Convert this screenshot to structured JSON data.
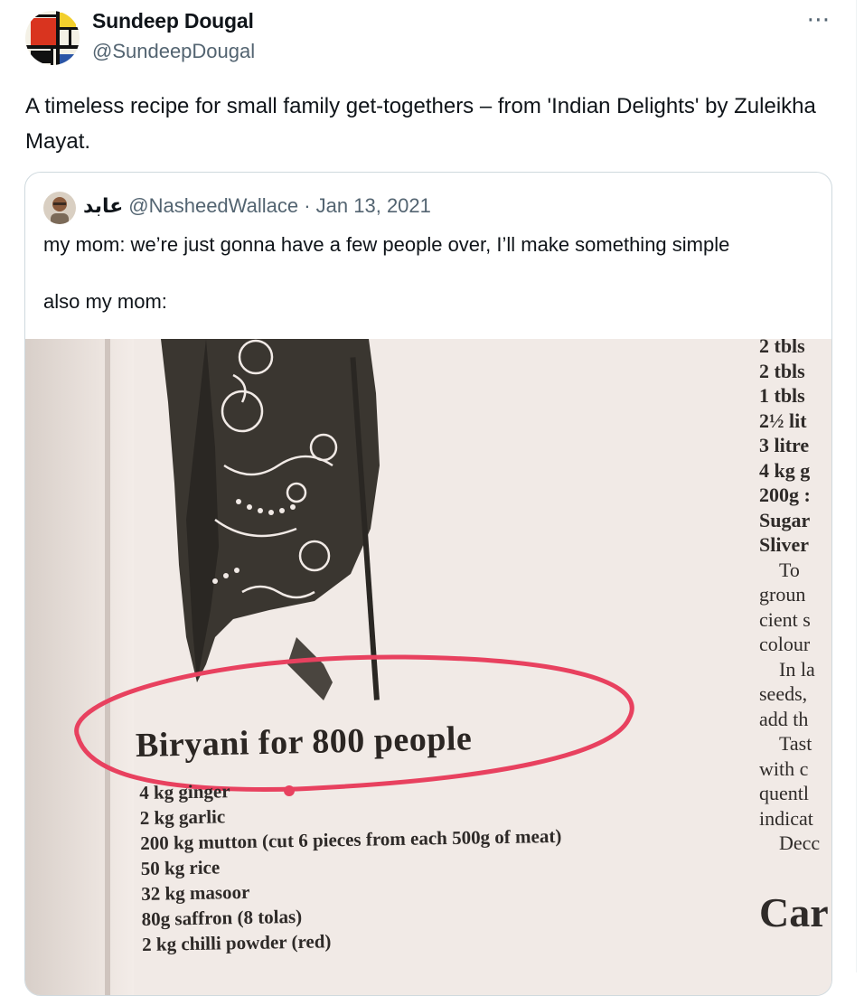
{
  "tweet": {
    "author_name": "Sundeep Dougal",
    "author_handle": "@SundeepDougal",
    "more_icon": "⋯",
    "text": "A timeless recipe for small family get-togethers – from 'Indian Delights' by Zuleikha Mayat."
  },
  "quoted": {
    "author_name": "عابد",
    "author_handle": "@NasheedWallace",
    "separator": "·",
    "date": "Jan 13, 2021",
    "line1": "my mom: we’re just gonna have a few people over, I’ll make something simple",
    "line2": "also my mom:"
  },
  "photo": {
    "title": "Biryani for 800 people",
    "ingredients": [
      "4 kg ginger",
      "2 kg garlic",
      "200 kg mutton (cut 6 pieces from each 500g of meat)",
      "50 kg rice",
      "32 kg masoor",
      "80g saffron (8 tolas)",
      "2 kg chilli powder (red)"
    ],
    "right_column": [
      {
        "t": "2 tbls",
        "c": "i"
      },
      {
        "t": "2 tbls",
        "c": "i"
      },
      {
        "t": "1 tbls",
        "c": "i"
      },
      {
        "t": "2½ lit",
        "c": "i"
      },
      {
        "t": "3 litre",
        "c": "i"
      },
      {
        "t": "4 kg g",
        "c": "i"
      },
      {
        "t": "200g :",
        "c": "i"
      },
      {
        "t": "Sugar",
        "c": "i"
      },
      {
        "t": "Sliver",
        "c": "i"
      },
      {
        "t": "To",
        "c": "t indent"
      },
      {
        "t": "groun",
        "c": "t"
      },
      {
        "t": "cient s",
        "c": "t"
      },
      {
        "t": "colour",
        "c": "t"
      },
      {
        "t": "In la",
        "c": "t indent"
      },
      {
        "t": "seeds,",
        "c": "t"
      },
      {
        "t": "add th",
        "c": "t"
      },
      {
        "t": "Tast",
        "c": "t indent"
      },
      {
        "t": "with c",
        "c": "t"
      },
      {
        "t": "quentl",
        "c": "t"
      },
      {
        "t": "indicat",
        "c": "t"
      },
      {
        "t": "Decc",
        "c": "t indent"
      }
    ],
    "right_heading": "Car"
  },
  "colors": {
    "text": "#0f1419",
    "secondary": "#536471",
    "border": "#cfd9de",
    "circle": "#e8415f"
  }
}
